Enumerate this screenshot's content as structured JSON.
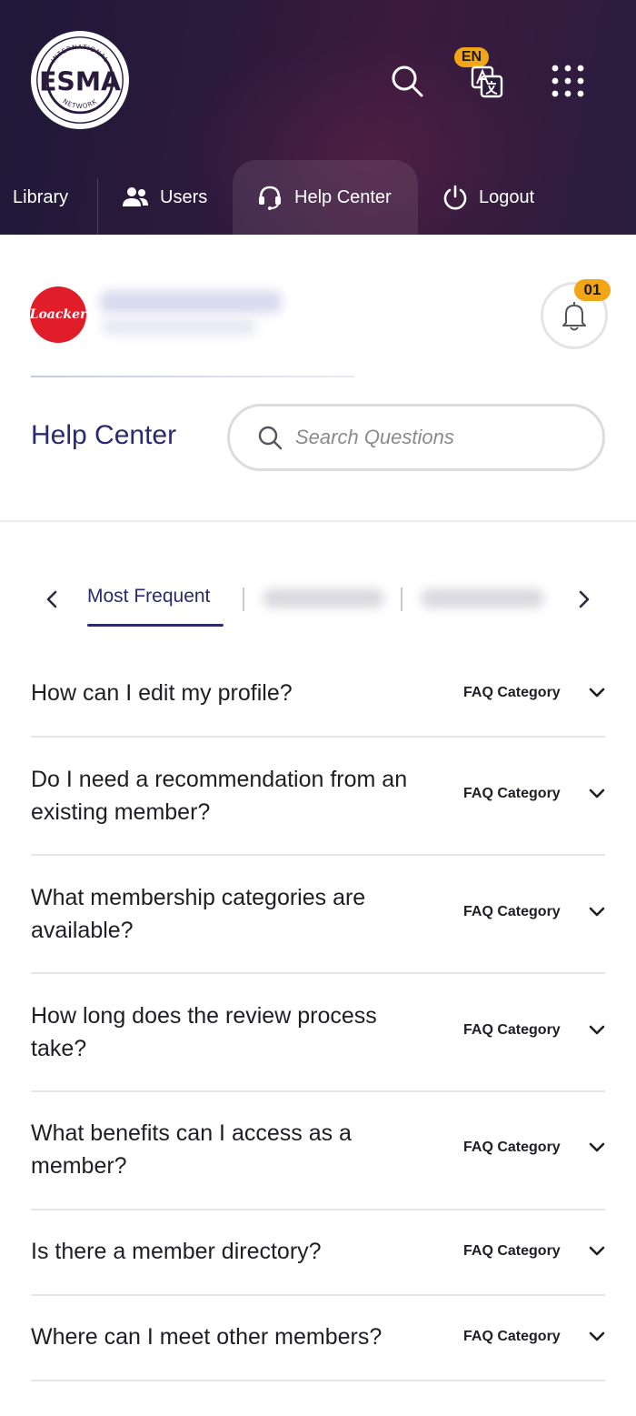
{
  "header": {
    "logo": {
      "main": "ESMA",
      "top_text": "INTERNATIONAL",
      "bottom_text": "NETWORK"
    },
    "language_badge": "EN",
    "icons": [
      "search-icon",
      "translate-icon",
      "apps-grid-icon"
    ]
  },
  "nav": {
    "items": [
      {
        "label": "Library",
        "icon": ""
      },
      {
        "label": "Users",
        "icon": "users-icon"
      },
      {
        "label": "Help Center",
        "icon": "headset-icon",
        "active": true
      },
      {
        "label": "Logout",
        "icon": "power-icon"
      }
    ]
  },
  "profile": {
    "avatar_text": "Loacker",
    "notification_count": "01"
  },
  "help": {
    "title": "Help Center",
    "search_placeholder": "Search Questions"
  },
  "tabs": {
    "active_label": "Most Frequent"
  },
  "faq": {
    "items": [
      {
        "question": "How can I edit my profile?",
        "category": "FAQ Category"
      },
      {
        "question": "Do I need a recommendation from an existing member?",
        "category": "FAQ Category"
      },
      {
        "question": "What membership categories are available?",
        "category": "FAQ Category"
      },
      {
        "question": "How long does the review process take?",
        "category": "FAQ Category"
      },
      {
        "question": "What benefits can I access as a member?",
        "category": "FAQ Category"
      },
      {
        "question": "Is there a member directory?",
        "category": "FAQ Category"
      },
      {
        "question": "Where can I meet other members?",
        "category": "FAQ Category"
      }
    ]
  },
  "colors": {
    "header_bg": "#2c1a3c",
    "accent_badge": "#f2a516",
    "title_navy": "#2a2a6e",
    "avatar_red": "#e11d2a"
  }
}
